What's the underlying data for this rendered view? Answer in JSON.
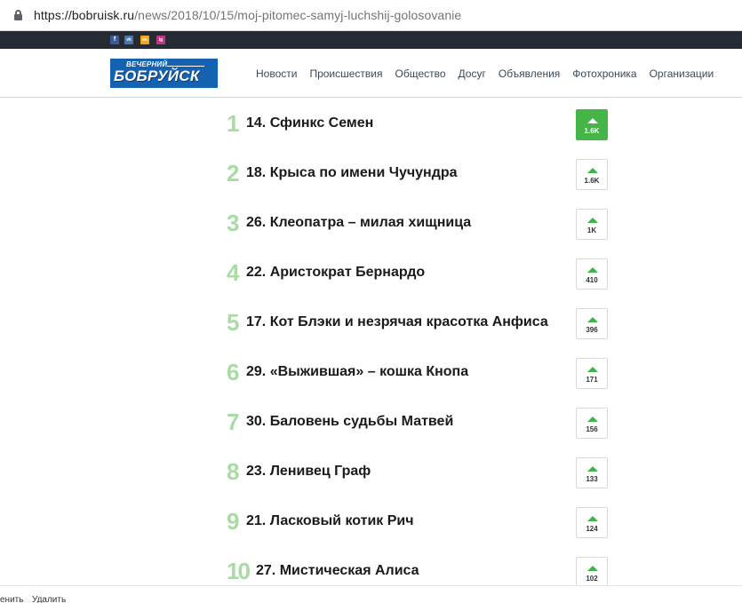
{
  "browser": {
    "url_host": "https://bobruisk.ru",
    "url_path": "/news/2018/10/15/moj-pitomec-samyj-luchshij-golosovanie"
  },
  "social": [
    {
      "icon": "facebook-icon",
      "glyph": "f",
      "color": "#3b5998"
    },
    {
      "icon": "vk-icon",
      "glyph": "vk",
      "color": "#4a76a8"
    },
    {
      "icon": "odnoklassniki-icon",
      "glyph": "ok",
      "color": "#f4a51c"
    },
    {
      "icon": "instagram-icon",
      "glyph": "ig",
      "color": "#c13584"
    }
  ],
  "logo": {
    "line1": "ВЕЧЕРНИЙ",
    "line2": "БОБРУЙСК"
  },
  "nav": [
    "Новости",
    "Происшествия",
    "Общество",
    "Досуг",
    "Объявления",
    "Фотохроника",
    "Организации"
  ],
  "items": [
    {
      "rank": "1",
      "title": "14. Сфинкс Семен",
      "votes": "1.6K"
    },
    {
      "rank": "2",
      "title": "18. Крыса по имени Чучундра",
      "votes": "1.6K"
    },
    {
      "rank": "3",
      "title": "26. Клеопатра – милая хищница",
      "votes": "1K"
    },
    {
      "rank": "4",
      "title": "22. Аристократ Бернардо",
      "votes": "410"
    },
    {
      "rank": "5",
      "title": "17. Кот Блэки и незрячая красотка Анфиса",
      "votes": "396"
    },
    {
      "rank": "6",
      "title": "29. «Выжившая» – кошка Кнопа",
      "votes": "171"
    },
    {
      "rank": "7",
      "title": "30. Баловень судьбы Матвей",
      "votes": "156"
    },
    {
      "rank": "8",
      "title": "23. Ленивец Граф",
      "votes": "133"
    },
    {
      "rank": "9",
      "title": "21. Ласковый котик Рич",
      "votes": "124"
    },
    {
      "rank": "10",
      "title": "27. Мистическая Алиса",
      "votes": "102"
    }
  ],
  "bottom": {
    "left": "енить",
    "right": "Удалить"
  },
  "colors": {
    "rank": "#a7dca2",
    "vote_active": "#46b548",
    "vote_arrow": "#3cb54a",
    "topbar": "#252a33",
    "logo_bg": "#1462b0"
  }
}
